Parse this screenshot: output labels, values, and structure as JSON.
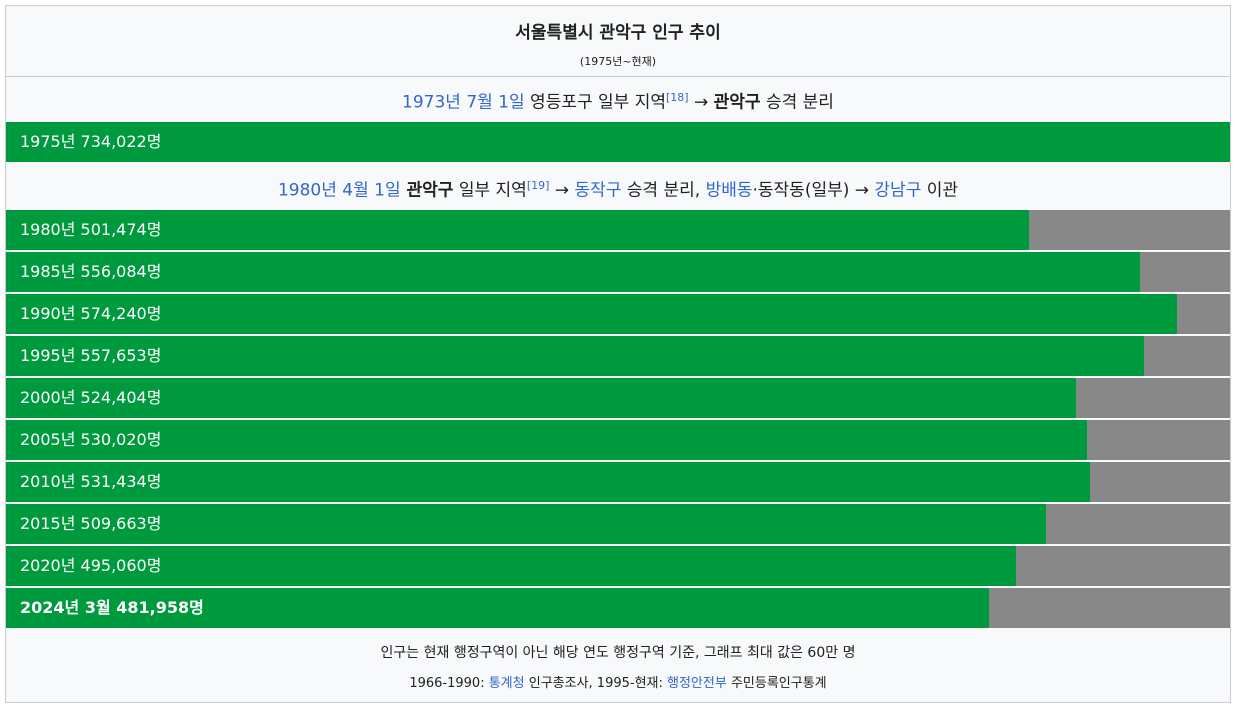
{
  "title": "서울특별시 관악구 인구 추이",
  "subtitle": "(1975년~현재)",
  "note1": {
    "date_link": "1973년 7월 1일",
    "text_a": " 영등포구 일부 지역",
    "ref": "[18]",
    "arrow": " → ",
    "bold": "관악구",
    "text_b": " 승격 분리"
  },
  "note2": {
    "date_link": "1980년 4월 1일",
    "bold": " 관악구",
    "text_a": " 일부 지역",
    "ref": "[19]",
    "arrow1": " → ",
    "link1": "동작구",
    "text_b": " 승격 분리, ",
    "link2": "방배동",
    "text_c": "·동작동(일부) → ",
    "link3": "강남구",
    "text_d": " 이관"
  },
  "footer": {
    "line1": "인구는 현재 행정구역이 아닌 해당 연도 행정구역 기준, 그래프 최대 값은 60만 명",
    "line2_a": "1966-1990: ",
    "line2_link1": "통계청",
    "line2_b": " 인구총조사, 1995-현재: ",
    "line2_link2": "행정안전부",
    "line2_c": " 주민등록인구통계"
  },
  "colors": {
    "bar": "#009a3e",
    "remainder": "#888888",
    "link": "#3366cc"
  },
  "chart_data": {
    "type": "bar",
    "orientation": "horizontal",
    "title": "서울특별시 관악구 인구 추이",
    "subtitle": "(1975년~현재)",
    "max_value": 600000,
    "categories": [
      "1975년",
      "1980년",
      "1985년",
      "1990년",
      "1995년",
      "2000년",
      "2005년",
      "2010년",
      "2015년",
      "2020년",
      "2024년 3월"
    ],
    "values": [
      734022,
      501474,
      556084,
      574240,
      557653,
      524404,
      530020,
      531434,
      509663,
      495060,
      481958
    ],
    "labels": [
      "1975년 734,022명",
      "1980년 501,474명",
      "1985년 556,084명",
      "1990년 574,240명",
      "1995년 557,653명",
      "2000년 524,404명",
      "2005년 530,020명",
      "2010년 531,434명",
      "2015년 509,663명",
      "2020년 495,060명",
      "2024년 3월 481,958명"
    ]
  }
}
